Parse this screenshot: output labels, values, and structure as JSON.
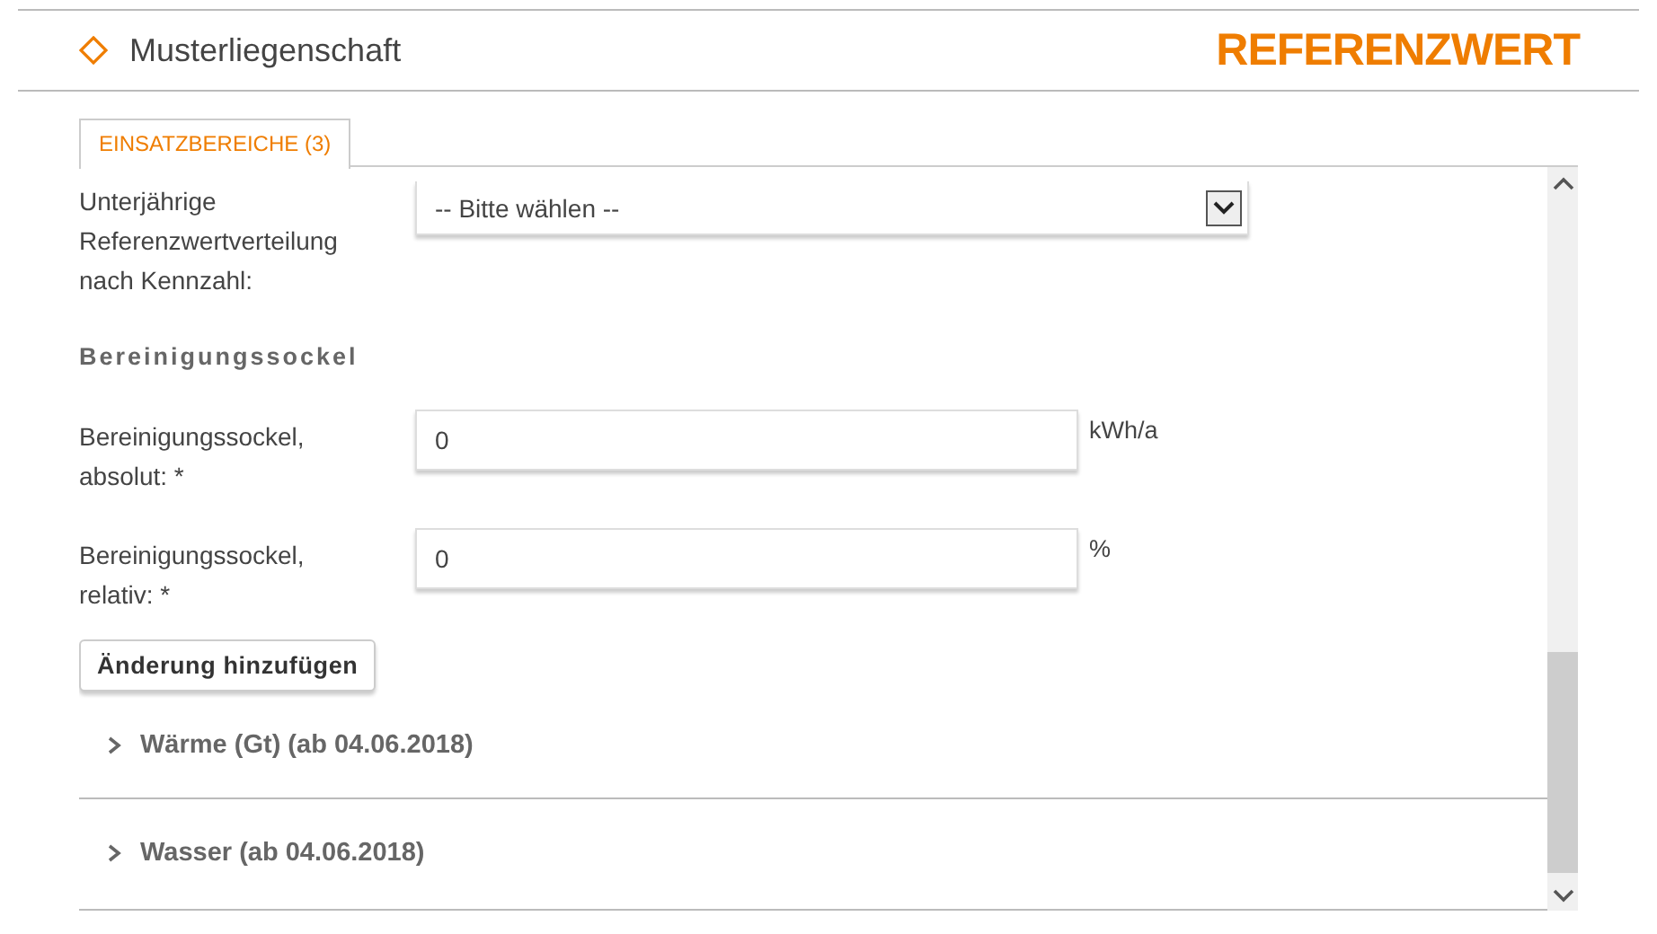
{
  "header": {
    "title": "Musterliegenschaft",
    "brand": "REFERENZWERT"
  },
  "tabs": [
    {
      "label": "EINSATZBEREICHE (3)",
      "selected": true
    }
  ],
  "distribution": {
    "label": "Unterjährige Referenzwertverteilung nach Kennzahl:",
    "value": "-- Bitte wählen --"
  },
  "section_title": "Bereinigungssockel",
  "fields": [
    {
      "label": "Bereinigungssockel, absolut: *",
      "value": "0",
      "unit": "kWh/a"
    },
    {
      "label": "Bereinigungssockel, relativ: *",
      "value": "0",
      "unit": "%"
    }
  ],
  "add_button": "Änderung hinzufügen",
  "accordion": [
    {
      "label": "Wärme (Gt) (ab 04.06.2018)",
      "expanded": false
    },
    {
      "label": "Wasser (ab 04.06.2018)",
      "expanded": false
    }
  ]
}
